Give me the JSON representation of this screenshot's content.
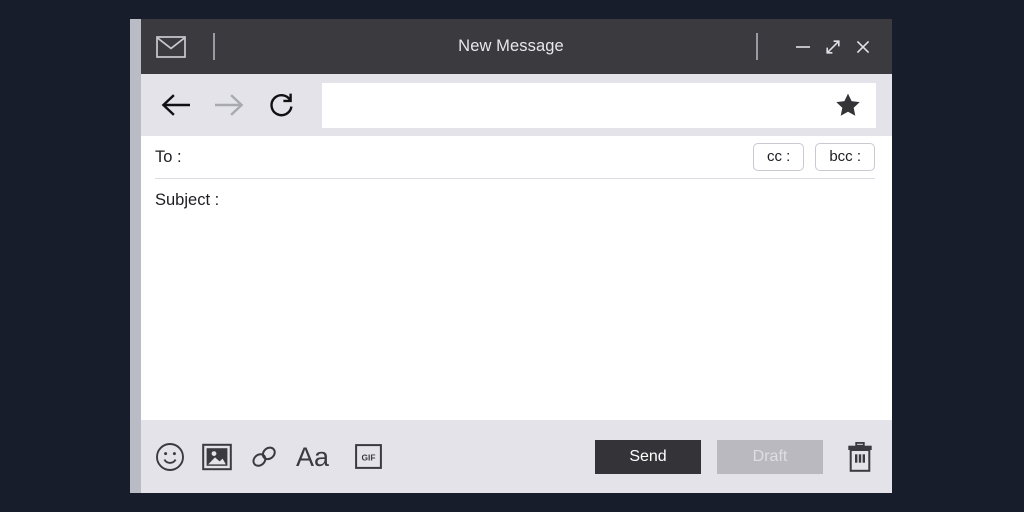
{
  "window": {
    "title": "New Message",
    "app_icon": "envelope-icon",
    "controls": [
      {
        "name": "minimize",
        "glyph": "minimize-icon"
      },
      {
        "name": "maximize",
        "glyph": "expand-diagonal-icon"
      },
      {
        "name": "close",
        "glyph": "close-icon"
      }
    ]
  },
  "navbar": {
    "back": "back-arrow-icon",
    "forward": "forward-arrow-icon",
    "reload": "reload-icon",
    "address_value": "",
    "address_placeholder": "",
    "bookmark": "star-filled-icon"
  },
  "fields": {
    "to_label": "To :",
    "to_value": "",
    "cc_label": "cc :",
    "bcc_label": "bcc :",
    "subject_label": "Subject :",
    "subject_value": "",
    "body_value": ""
  },
  "toolbar": {
    "icons": [
      {
        "name": "emoji-icon",
        "label": "emoji"
      },
      {
        "name": "image-icon",
        "label": "image"
      },
      {
        "name": "link-icon",
        "label": "link"
      },
      {
        "name": "font-icon",
        "label": "Aa"
      },
      {
        "name": "gif-icon",
        "label": "GIF"
      }
    ],
    "send_label": "Send",
    "draft_label": "Draft",
    "delete_icon": "trash-icon"
  },
  "colors": {
    "backdrop": "#171d2b",
    "titlebar": "#3a3a3f",
    "toolbar": "#e3e3e9",
    "content": "#ffffff",
    "frame_strip": "#b9bcc4",
    "send_bg": "#343438",
    "draft_bg": "#b9b9bf",
    "draft_fg": "#dedee3",
    "ink": "#1d1d22"
  }
}
